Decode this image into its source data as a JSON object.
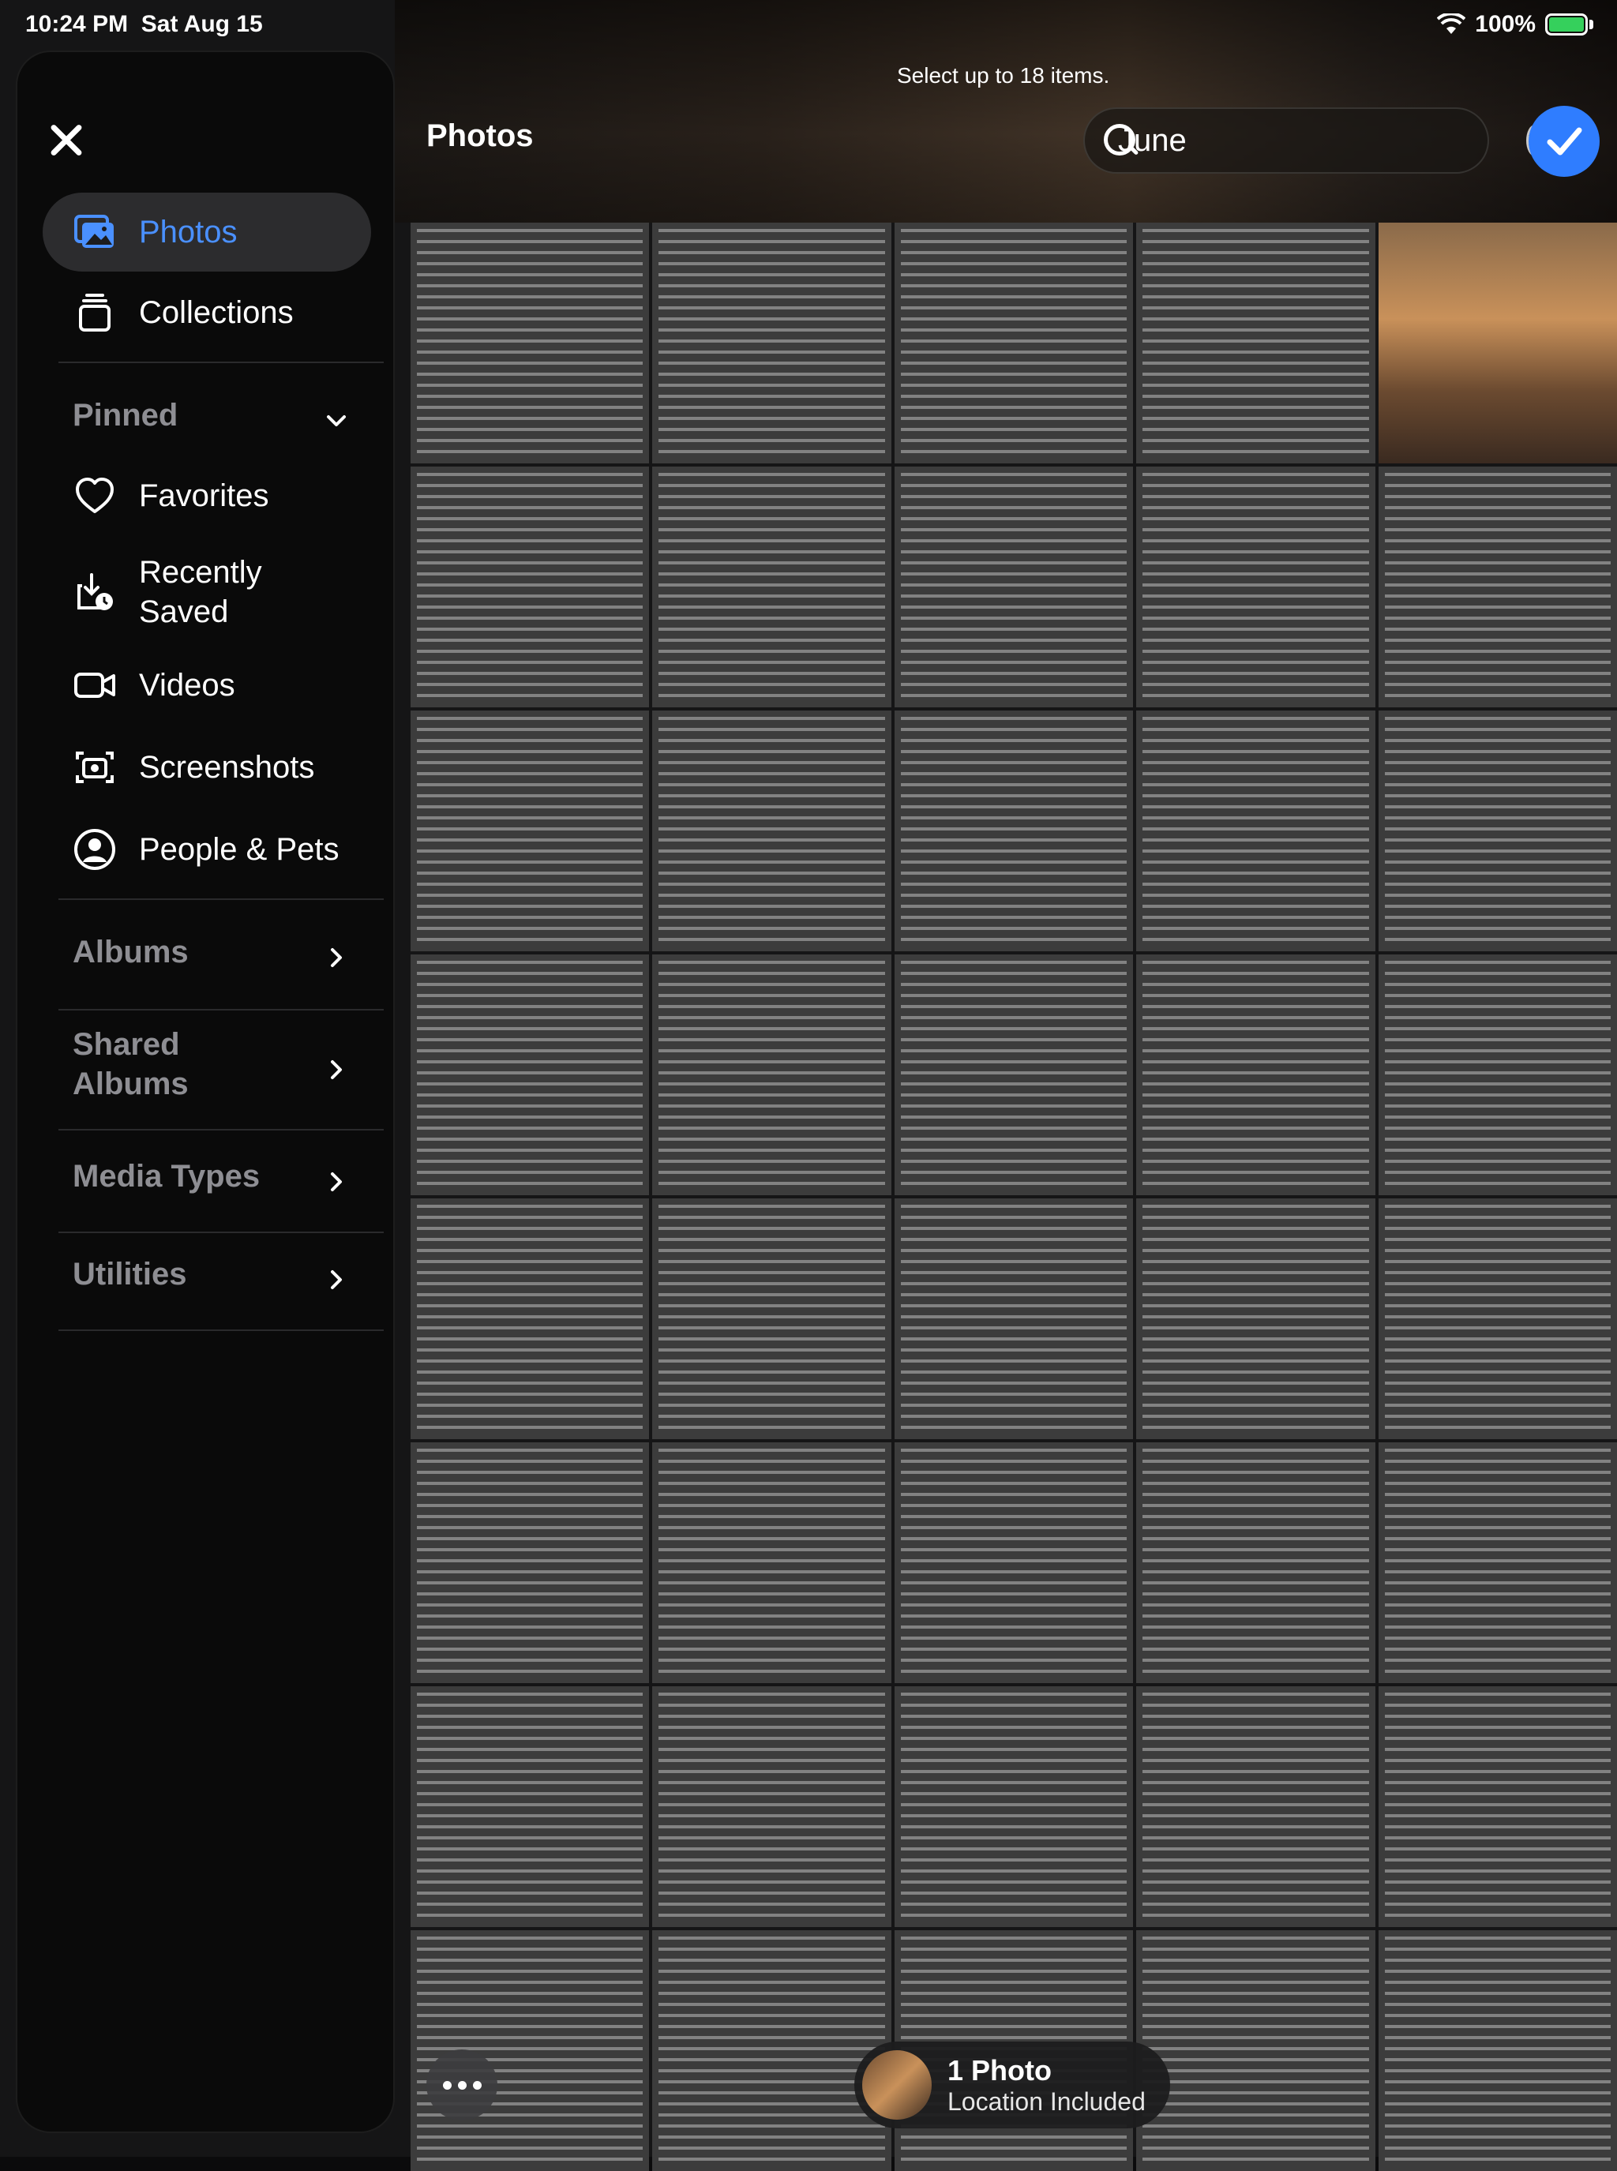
{
  "status_bar": {
    "time": "10:24 PM",
    "date": "Sat Aug 15",
    "battery": "100%"
  },
  "header": {
    "hint": "Select up to 18 items.",
    "title": "Photos",
    "search": {
      "value": "June",
      "placeholder": "Search"
    }
  },
  "sidebar": {
    "items": [
      {
        "label": "Photos",
        "icon": "photos-icon"
      },
      {
        "label": "Collections",
        "icon": "collections-icon"
      },
      {
        "label": "Favorites",
        "icon": "heart-icon"
      },
      {
        "label": "Recently Saved",
        "icon": "recently-saved-icon"
      },
      {
        "label": "Videos",
        "icon": "video-icon"
      },
      {
        "label": "Screenshots",
        "icon": "screenshot-icon"
      },
      {
        "label": "People & Pets",
        "icon": "person-icon"
      }
    ],
    "sections": {
      "pinned": "Pinned",
      "albums": "Albums",
      "shared_albums": "Shared Albums",
      "media_types": "Media Types",
      "utilities": "Utilities"
    }
  },
  "selection": {
    "count_label": "1 Photo",
    "location_label": "Location Included"
  },
  "colors": {
    "accent": "#2f7dff",
    "sidebar_active_text": "#4a90ff",
    "section_text": "#8e8e93"
  }
}
